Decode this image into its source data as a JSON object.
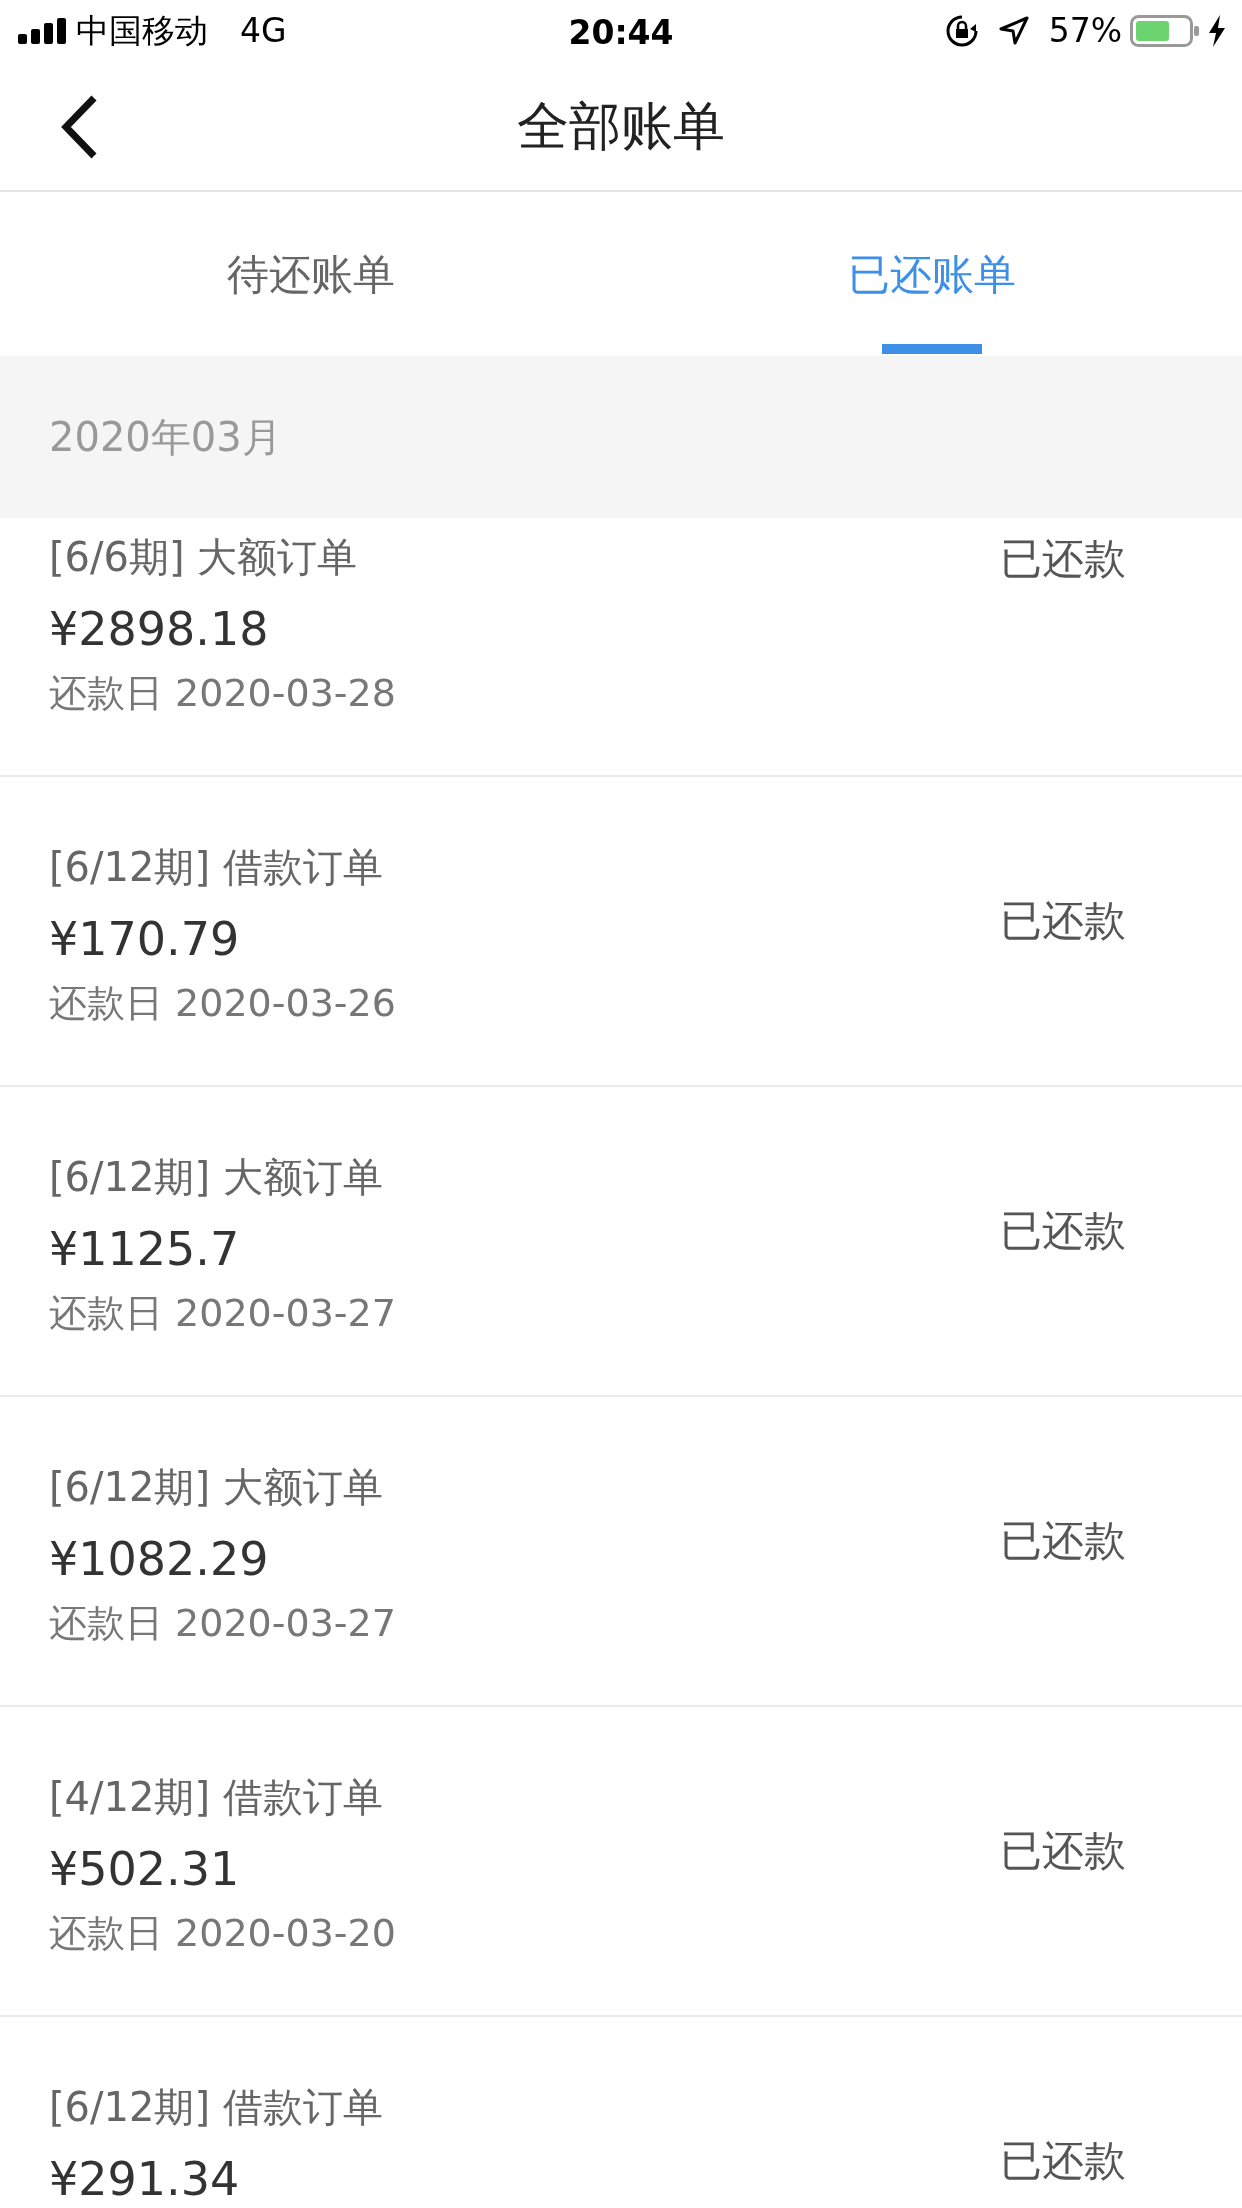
{
  "status_bar": {
    "carrier": "中国移动",
    "network": "4G",
    "time": "20:44",
    "battery": "57%"
  },
  "nav": {
    "title": "全部账单"
  },
  "tabs": [
    {
      "label": "待还账单",
      "selected": false
    },
    {
      "label": "已还账单",
      "selected": true
    }
  ],
  "month_header": "2020年03月",
  "bills": [
    {
      "title": "[6/6期] 大额订单",
      "amount": "¥2898.18",
      "due_date": "还款日 2020-03-28",
      "status": "已还款"
    },
    {
      "title": "[6/12期] 借款订单",
      "amount": "¥170.79",
      "due_date": "还款日 2020-03-26",
      "status": "已还款"
    },
    {
      "title": "[6/12期] 大额订单",
      "amount": "¥1125.7",
      "due_date": "还款日 2020-03-27",
      "status": "已还款"
    },
    {
      "title": "[6/12期] 大额订单",
      "amount": "¥1082.29",
      "due_date": "还款日 2020-03-27",
      "status": "已还款"
    },
    {
      "title": "[4/12期] 借款订单",
      "amount": "¥502.31",
      "due_date": "还款日 2020-03-20",
      "status": "已还款"
    },
    {
      "title": "[6/12期] 借款订单",
      "amount": "¥291.34",
      "status": "已还款"
    }
  ]
}
